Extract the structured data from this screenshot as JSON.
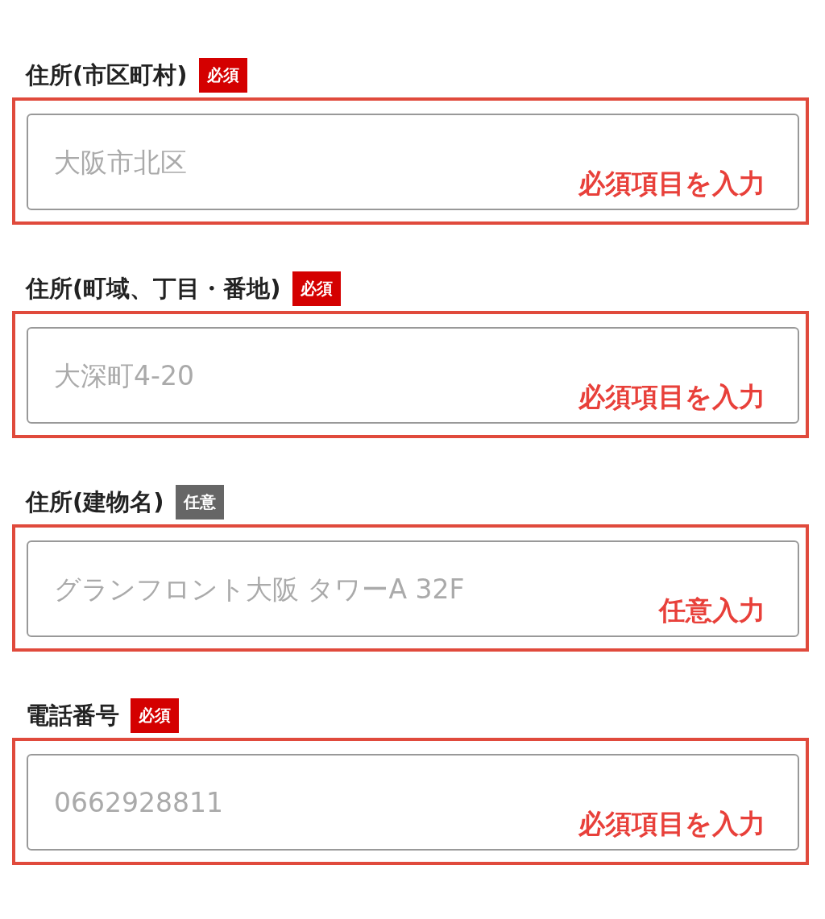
{
  "fields": [
    {
      "label": "住所(市区町村)",
      "badge": {
        "text": "必須",
        "kind": "required"
      },
      "placeholder": "大阪市北区",
      "annotation": "必須項目を入力"
    },
    {
      "label": "住所(町域、丁目・番地)",
      "badge": {
        "text": "必須",
        "kind": "required"
      },
      "placeholder": "大深町4-20",
      "annotation": "必須項目を入力"
    },
    {
      "label": "住所(建物名)",
      "badge": {
        "text": "任意",
        "kind": "optional"
      },
      "placeholder": "グランフロント大阪 タワーA 32F",
      "annotation": "任意入力"
    },
    {
      "label": "電話番号",
      "badge": {
        "text": "必須",
        "kind": "required"
      },
      "placeholder": "0662928811",
      "annotation": "必須項目を入力"
    }
  ]
}
